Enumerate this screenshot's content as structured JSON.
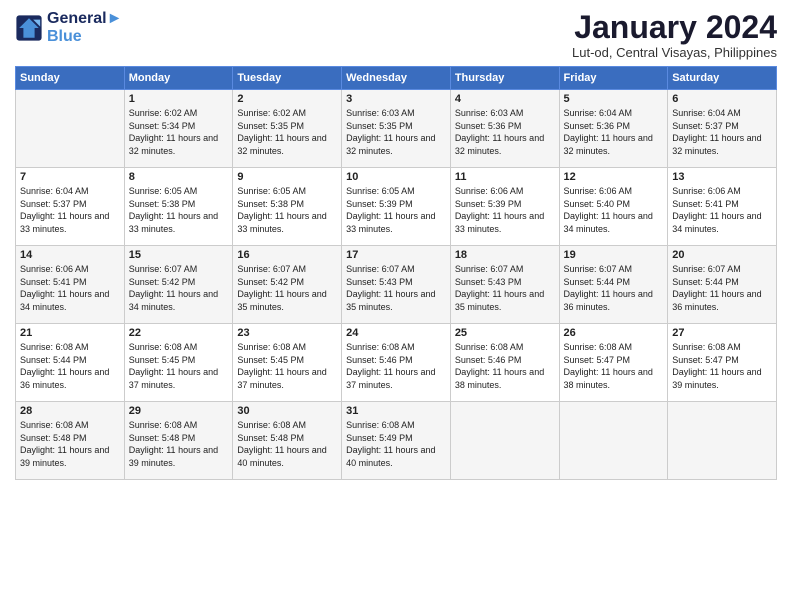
{
  "logo": {
    "line1": "General",
    "line2": "Blue"
  },
  "title": "January 2024",
  "location": "Lut-od, Central Visayas, Philippines",
  "days_of_week": [
    "Sunday",
    "Monday",
    "Tuesday",
    "Wednesday",
    "Thursday",
    "Friday",
    "Saturday"
  ],
  "weeks": [
    [
      {
        "num": "",
        "sunrise": "",
        "sunset": "",
        "daylight": ""
      },
      {
        "num": "1",
        "sunrise": "Sunrise: 6:02 AM",
        "sunset": "Sunset: 5:34 PM",
        "daylight": "Daylight: 11 hours and 32 minutes."
      },
      {
        "num": "2",
        "sunrise": "Sunrise: 6:02 AM",
        "sunset": "Sunset: 5:35 PM",
        "daylight": "Daylight: 11 hours and 32 minutes."
      },
      {
        "num": "3",
        "sunrise": "Sunrise: 6:03 AM",
        "sunset": "Sunset: 5:35 PM",
        "daylight": "Daylight: 11 hours and 32 minutes."
      },
      {
        "num": "4",
        "sunrise": "Sunrise: 6:03 AM",
        "sunset": "Sunset: 5:36 PM",
        "daylight": "Daylight: 11 hours and 32 minutes."
      },
      {
        "num": "5",
        "sunrise": "Sunrise: 6:04 AM",
        "sunset": "Sunset: 5:36 PM",
        "daylight": "Daylight: 11 hours and 32 minutes."
      },
      {
        "num": "6",
        "sunrise": "Sunrise: 6:04 AM",
        "sunset": "Sunset: 5:37 PM",
        "daylight": "Daylight: 11 hours and 32 minutes."
      }
    ],
    [
      {
        "num": "7",
        "sunrise": "Sunrise: 6:04 AM",
        "sunset": "Sunset: 5:37 PM",
        "daylight": "Daylight: 11 hours and 33 minutes."
      },
      {
        "num": "8",
        "sunrise": "Sunrise: 6:05 AM",
        "sunset": "Sunset: 5:38 PM",
        "daylight": "Daylight: 11 hours and 33 minutes."
      },
      {
        "num": "9",
        "sunrise": "Sunrise: 6:05 AM",
        "sunset": "Sunset: 5:38 PM",
        "daylight": "Daylight: 11 hours and 33 minutes."
      },
      {
        "num": "10",
        "sunrise": "Sunrise: 6:05 AM",
        "sunset": "Sunset: 5:39 PM",
        "daylight": "Daylight: 11 hours and 33 minutes."
      },
      {
        "num": "11",
        "sunrise": "Sunrise: 6:06 AM",
        "sunset": "Sunset: 5:39 PM",
        "daylight": "Daylight: 11 hours and 33 minutes."
      },
      {
        "num": "12",
        "sunrise": "Sunrise: 6:06 AM",
        "sunset": "Sunset: 5:40 PM",
        "daylight": "Daylight: 11 hours and 34 minutes."
      },
      {
        "num": "13",
        "sunrise": "Sunrise: 6:06 AM",
        "sunset": "Sunset: 5:41 PM",
        "daylight": "Daylight: 11 hours and 34 minutes."
      }
    ],
    [
      {
        "num": "14",
        "sunrise": "Sunrise: 6:06 AM",
        "sunset": "Sunset: 5:41 PM",
        "daylight": "Daylight: 11 hours and 34 minutes."
      },
      {
        "num": "15",
        "sunrise": "Sunrise: 6:07 AM",
        "sunset": "Sunset: 5:42 PM",
        "daylight": "Daylight: 11 hours and 34 minutes."
      },
      {
        "num": "16",
        "sunrise": "Sunrise: 6:07 AM",
        "sunset": "Sunset: 5:42 PM",
        "daylight": "Daylight: 11 hours and 35 minutes."
      },
      {
        "num": "17",
        "sunrise": "Sunrise: 6:07 AM",
        "sunset": "Sunset: 5:43 PM",
        "daylight": "Daylight: 11 hours and 35 minutes."
      },
      {
        "num": "18",
        "sunrise": "Sunrise: 6:07 AM",
        "sunset": "Sunset: 5:43 PM",
        "daylight": "Daylight: 11 hours and 35 minutes."
      },
      {
        "num": "19",
        "sunrise": "Sunrise: 6:07 AM",
        "sunset": "Sunset: 5:44 PM",
        "daylight": "Daylight: 11 hours and 36 minutes."
      },
      {
        "num": "20",
        "sunrise": "Sunrise: 6:07 AM",
        "sunset": "Sunset: 5:44 PM",
        "daylight": "Daylight: 11 hours and 36 minutes."
      }
    ],
    [
      {
        "num": "21",
        "sunrise": "Sunrise: 6:08 AM",
        "sunset": "Sunset: 5:44 PM",
        "daylight": "Daylight: 11 hours and 36 minutes."
      },
      {
        "num": "22",
        "sunrise": "Sunrise: 6:08 AM",
        "sunset": "Sunset: 5:45 PM",
        "daylight": "Daylight: 11 hours and 37 minutes."
      },
      {
        "num": "23",
        "sunrise": "Sunrise: 6:08 AM",
        "sunset": "Sunset: 5:45 PM",
        "daylight": "Daylight: 11 hours and 37 minutes."
      },
      {
        "num": "24",
        "sunrise": "Sunrise: 6:08 AM",
        "sunset": "Sunset: 5:46 PM",
        "daylight": "Daylight: 11 hours and 37 minutes."
      },
      {
        "num": "25",
        "sunrise": "Sunrise: 6:08 AM",
        "sunset": "Sunset: 5:46 PM",
        "daylight": "Daylight: 11 hours and 38 minutes."
      },
      {
        "num": "26",
        "sunrise": "Sunrise: 6:08 AM",
        "sunset": "Sunset: 5:47 PM",
        "daylight": "Daylight: 11 hours and 38 minutes."
      },
      {
        "num": "27",
        "sunrise": "Sunrise: 6:08 AM",
        "sunset": "Sunset: 5:47 PM",
        "daylight": "Daylight: 11 hours and 39 minutes."
      }
    ],
    [
      {
        "num": "28",
        "sunrise": "Sunrise: 6:08 AM",
        "sunset": "Sunset: 5:48 PM",
        "daylight": "Daylight: 11 hours and 39 minutes."
      },
      {
        "num": "29",
        "sunrise": "Sunrise: 6:08 AM",
        "sunset": "Sunset: 5:48 PM",
        "daylight": "Daylight: 11 hours and 39 minutes."
      },
      {
        "num": "30",
        "sunrise": "Sunrise: 6:08 AM",
        "sunset": "Sunset: 5:48 PM",
        "daylight": "Daylight: 11 hours and 40 minutes."
      },
      {
        "num": "31",
        "sunrise": "Sunrise: 6:08 AM",
        "sunset": "Sunset: 5:49 PM",
        "daylight": "Daylight: 11 hours and 40 minutes."
      },
      {
        "num": "",
        "sunrise": "",
        "sunset": "",
        "daylight": ""
      },
      {
        "num": "",
        "sunrise": "",
        "sunset": "",
        "daylight": ""
      },
      {
        "num": "",
        "sunrise": "",
        "sunset": "",
        "daylight": ""
      }
    ]
  ]
}
